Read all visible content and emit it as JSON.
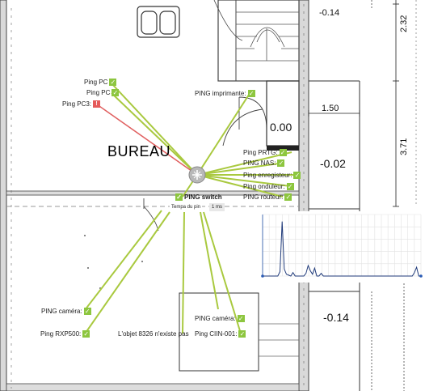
{
  "room_label": "BUREAU",
  "dimensions": {
    "top_right": "-0.14",
    "d232": "2.32",
    "d150": "1.50",
    "d000": "0.00",
    "d371": "3.71",
    "d002": "-0.02",
    "bottom_right": "-0.14"
  },
  "sensors": {
    "ping_pc_1": "Ping PC",
    "ping_pc_2": "Ping PC",
    "ping_pc3": "Ping PC3:",
    "ping_printer": "PING imprimante:",
    "ping_prtg": "Ping PRTG:",
    "ping_nas": "PING NAS:",
    "ping_recorder": "Ping enregisteur:",
    "ping_ups": "Ping onduleur:",
    "ping_router": "PING routeur:",
    "ping_switch": "PING switch",
    "camera_1": "PING caméra:",
    "rxp500": "Ping RXP500:",
    "missing_object": "L'objet 8326 n'existe pas",
    "camera_2": "PING caméra:",
    "ciin": "Ping CIIN-001:"
  },
  "status_icons": {
    "ok": "check-icon",
    "error_mark": "!"
  },
  "tooltip": {
    "left": "Tempa du pin",
    "right": "1 ms"
  },
  "colors": {
    "link_ok": "#a9c93f",
    "link_error": "#e06060",
    "wall": "#555555",
    "chart_line": "#1f3a7a"
  },
  "chart_data": {
    "type": "line",
    "title": "",
    "xlabel": "",
    "ylabel": "",
    "grid": true,
    "series": [
      {
        "values": [
          0,
          0,
          0,
          0,
          0,
          0,
          0,
          0,
          5,
          62,
          8,
          2,
          1,
          0,
          4,
          0,
          0,
          0,
          0,
          0,
          3,
          12,
          6,
          2,
          9,
          0,
          0,
          3,
          0,
          0,
          0,
          0,
          0,
          0,
          0,
          0,
          0,
          0,
          0,
          0,
          0,
          0,
          0,
          0,
          0,
          0,
          0,
          0,
          0,
          0,
          0,
          0,
          0,
          0,
          0,
          0,
          0,
          0,
          0,
          0,
          0,
          0,
          0,
          0,
          0,
          0,
          0,
          0,
          0,
          0,
          4,
          10,
          0,
          0
        ]
      }
    ]
  }
}
